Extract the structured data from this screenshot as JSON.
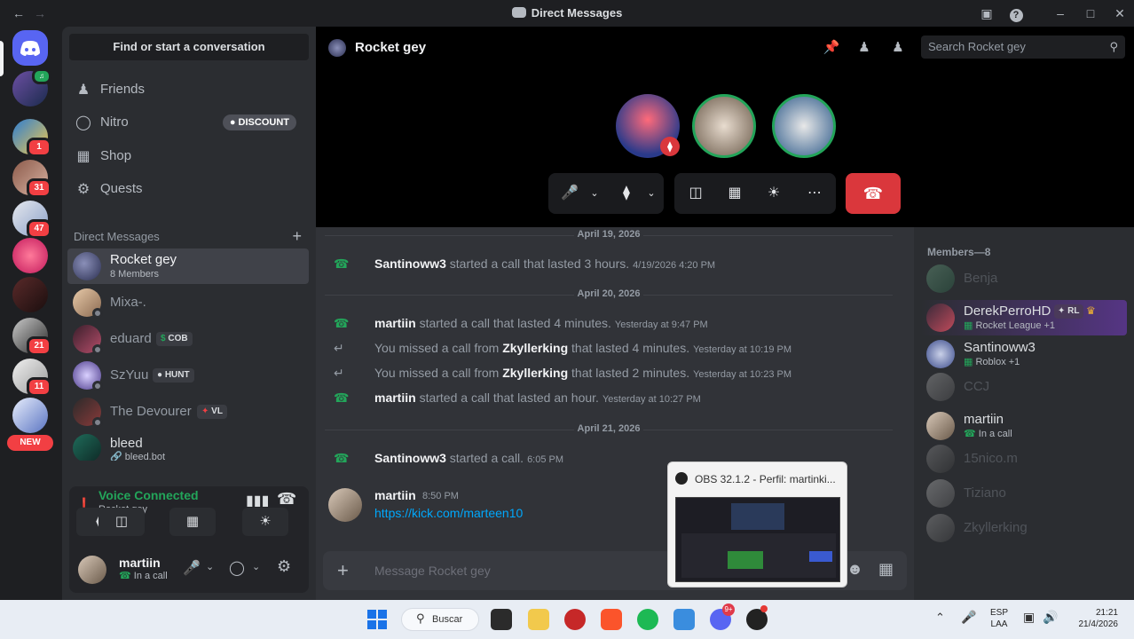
{
  "titlebar": {
    "title": "Direct Messages"
  },
  "rail": {
    "new_label": "NEW",
    "badges": [
      "1",
      "31",
      "47",
      "21",
      "11"
    ]
  },
  "sidebar": {
    "search_label": "Find or start a conversation",
    "nav": [
      {
        "label": "Friends",
        "icon": "friends-icon"
      },
      {
        "label": "Nitro",
        "icon": "nitro-icon"
      },
      {
        "label": "Shop",
        "icon": "shop-icon"
      },
      {
        "label": "Quests",
        "icon": "quests-icon"
      }
    ],
    "discount_label": "DISCOUNT",
    "dm_header": "Direct Messages",
    "dms": [
      {
        "name": "Rocket gey",
        "sub": "8 Members"
      },
      {
        "name": "Mixa-."
      },
      {
        "name": "eduard",
        "tag": "COB"
      },
      {
        "name": "SzYuu",
        "tag": "HUNT"
      },
      {
        "name": "The Devourer",
        "tag": "VL"
      },
      {
        "name": "bleed",
        "sub": "bleed.bot"
      }
    ]
  },
  "voice": {
    "status": "Voice Connected",
    "channel": "Rocket gey"
  },
  "user": {
    "name": "martiin",
    "status": "In a call"
  },
  "call": {
    "channel_name": "Rocket gey",
    "search_placeholder": "Search Rocket gey"
  },
  "chat": {
    "days": [
      "April 19, 2026",
      "April 20, 2026",
      "April 21, 2026"
    ],
    "events": [
      {
        "who": "Santinoww3",
        "text": "started a call that lasted 3 hours.",
        "ts": "4/19/2026 4:20 PM",
        "missed": false
      },
      {
        "who": "martiin",
        "text": "started a call that lasted 4 minutes.",
        "ts": "Yesterday at 9:47 PM",
        "missed": false
      },
      {
        "pre": "You missed a call from",
        "who": "Zkyllerking",
        "text": "that lasted 4 minutes.",
        "ts": "Yesterday at 10:19 PM",
        "missed": true
      },
      {
        "pre": "You missed a call from",
        "who": "Zkyllerking",
        "text": "that lasted 2 minutes.",
        "ts": "Yesterday at 10:23 PM",
        "missed": true
      },
      {
        "who": "martiin",
        "text": "started a call that lasted an hour.",
        "ts": "Yesterday at 10:27 PM",
        "missed": false
      },
      {
        "who": "Santinoww3",
        "text": "started a call.",
        "ts": "6:05 PM",
        "missed": false
      }
    ],
    "message": {
      "author": "martiin",
      "time": "8:50 PM",
      "link": "https://kick.com/marteen10"
    },
    "input_placeholder": "Message Rocket gey"
  },
  "members": {
    "header": "Members—8",
    "list": [
      {
        "name": "Benja",
        "online": false
      },
      {
        "name": "DerekPerroHD",
        "sub": "Rocket League +1",
        "tag": "RL",
        "online": true
      },
      {
        "name": "Santinoww3",
        "sub": "Roblox +1",
        "online": true
      },
      {
        "name": "CCJ",
        "online": false
      },
      {
        "name": "martiin",
        "sub": "In a call",
        "online": true
      },
      {
        "name": "15nico.m",
        "online": false
      },
      {
        "name": "Tiziano",
        "online": false
      },
      {
        "name": "Zkyllerking",
        "online": false
      }
    ]
  },
  "obs": {
    "title": "OBS 32.1.2 - Perfil: martinki..."
  },
  "taskbar": {
    "search_label": "Buscar",
    "lang": "ESP",
    "lang_sub": "LAA",
    "time": "21:21",
    "date": "21/4/2026",
    "discord_badge": "9+"
  },
  "colors": {
    "accent": "#5865f2",
    "green": "#23a55a",
    "red": "#da373c"
  }
}
